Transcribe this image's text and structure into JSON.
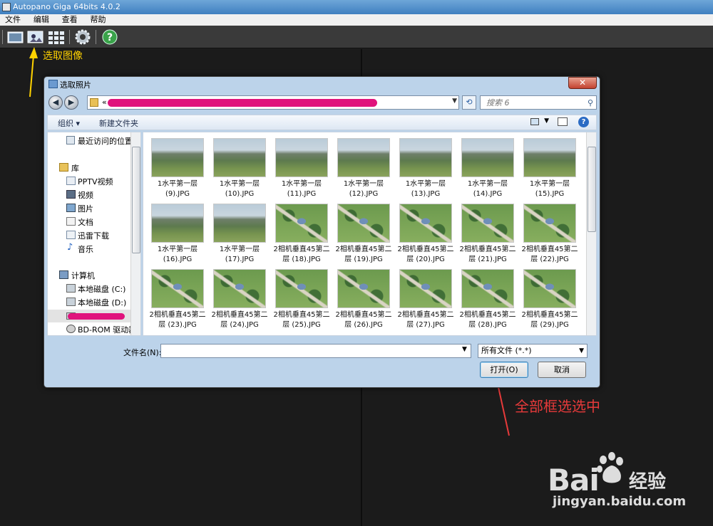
{
  "app": {
    "title": "Autopano Giga 64bits 4.0.2",
    "menu": [
      "文件",
      "编辑",
      "查看",
      "帮助"
    ],
    "toolbar_icons": [
      "new-panorama-icon",
      "import-images-icon",
      "group-images-icon",
      "settings-gear-icon",
      "help-icon"
    ]
  },
  "annotations": {
    "select_image": "选取图像",
    "select_all": "全部框选选中"
  },
  "dialog": {
    "title": "选取照片",
    "close": "✕",
    "search_placeholder": "搜索 6",
    "address_prefix": "«",
    "commands": {
      "organize": "组织 ▾",
      "new_folder": "新建文件夹"
    },
    "nav": {
      "recent": "最近访问的位置",
      "library": "库",
      "items": [
        "PPTV视频",
        "视频",
        "图片",
        "文档",
        "迅雷下载",
        "音乐"
      ],
      "computer": "计算机",
      "drives": [
        "本地磁盘 (C:)",
        "本地磁盘 (D:)"
      ],
      "bdrom": "BD-ROM 驱动器"
    },
    "files": [
      {
        "line1": "1水平第一层",
        "line2": "(9).JPG",
        "kind": "landscape"
      },
      {
        "line1": "1水平第一层",
        "line2": "(10).JPG",
        "kind": "landscape"
      },
      {
        "line1": "1水平第一层",
        "line2": "(11).JPG",
        "kind": "landscape"
      },
      {
        "line1": "1水平第一层",
        "line2": "(12).JPG",
        "kind": "landscape"
      },
      {
        "line1": "1水平第一层",
        "line2": "(13).JPG",
        "kind": "landscape"
      },
      {
        "line1": "1水平第一层",
        "line2": "(14).JPG",
        "kind": "landscape"
      },
      {
        "line1": "1水平第一层",
        "line2": "(15).JPG",
        "kind": "landscape"
      },
      {
        "line1": "1水平第一层",
        "line2": "(16).JPG",
        "kind": "landscape"
      },
      {
        "line1": "1水平第一层",
        "line2": "(17).JPG",
        "kind": "landscape"
      },
      {
        "line1": "2相机垂直45第二",
        "line2": "层 (18).JPG",
        "kind": "aerial"
      },
      {
        "line1": "2相机垂直45第二",
        "line2": "层 (19).JPG",
        "kind": "aerial"
      },
      {
        "line1": "2相机垂直45第二",
        "line2": "层 (20).JPG",
        "kind": "aerial"
      },
      {
        "line1": "2相机垂直45第二",
        "line2": "层 (21).JPG",
        "kind": "aerial"
      },
      {
        "line1": "2相机垂直45第二",
        "line2": "层 (22).JPG",
        "kind": "aerial"
      },
      {
        "line1": "2相机垂直45第二",
        "line2": "层 (23).JPG",
        "kind": "aerial"
      },
      {
        "line1": "2相机垂直45第二",
        "line2": "层 (24).JPG",
        "kind": "aerial"
      },
      {
        "line1": "2相机垂直45第二",
        "line2": "层 (25).JPG",
        "kind": "aerial"
      },
      {
        "line1": "2相机垂直45第二",
        "line2": "层 (26).JPG",
        "kind": "aerial"
      },
      {
        "line1": "2相机垂直45第二",
        "line2": "层 (27).JPG",
        "kind": "aerial"
      },
      {
        "line1": "2相机垂直45第二",
        "line2": "层 (28).JPG",
        "kind": "aerial"
      },
      {
        "line1": "2相机垂直45第二",
        "line2": "层 (29).JPG",
        "kind": "aerial"
      }
    ],
    "filename_label": "文件名(N):",
    "filename_value": "",
    "filetype": "所有文件 (*.*)",
    "open_button": "打开(O)",
    "cancel_button": "取消"
  },
  "watermark": {
    "logo": "Bai",
    "logo_tail": "经验",
    "url": "jingyan.baidu.com"
  },
  "colors": {
    "annotation_yellow": "#ffd200",
    "annotation_red": "#e63a3a",
    "redaction_pink": "#e0137c"
  }
}
